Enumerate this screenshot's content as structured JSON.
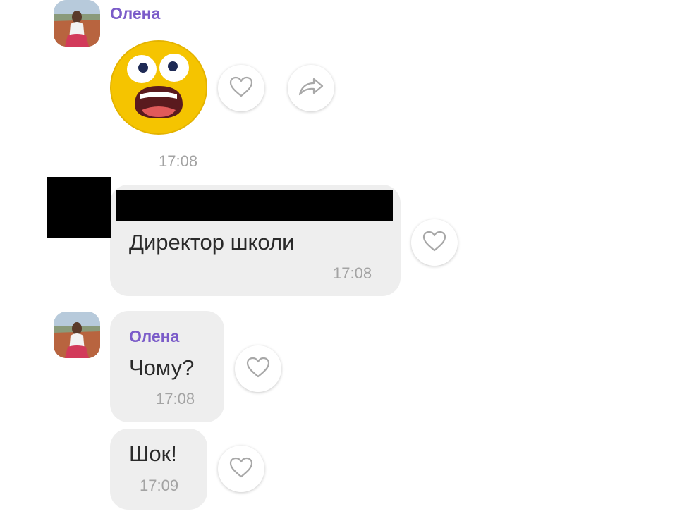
{
  "messages": [
    {
      "sender": "Олена",
      "type": "sticker",
      "sticker": "shocked-emoji-sticker",
      "time": "17:08"
    },
    {
      "type": "text",
      "text": "Директор школи",
      "time": "17:08",
      "reply_preview_redacted": true
    },
    {
      "sender": "Олена",
      "type": "text",
      "text": "Чому?",
      "time": "17:08"
    },
    {
      "type": "text",
      "text": "Шок!",
      "time": "17:09"
    }
  ],
  "icons": {
    "like": "heart-outline-icon",
    "forward": "forward-arrow-icon"
  },
  "colors": {
    "sender_name": "#7b5cc9",
    "bubble": "#eeeeee",
    "timestamp": "#a3a3a3",
    "redaction": "#000000",
    "sticker_face": "#f5c400"
  }
}
